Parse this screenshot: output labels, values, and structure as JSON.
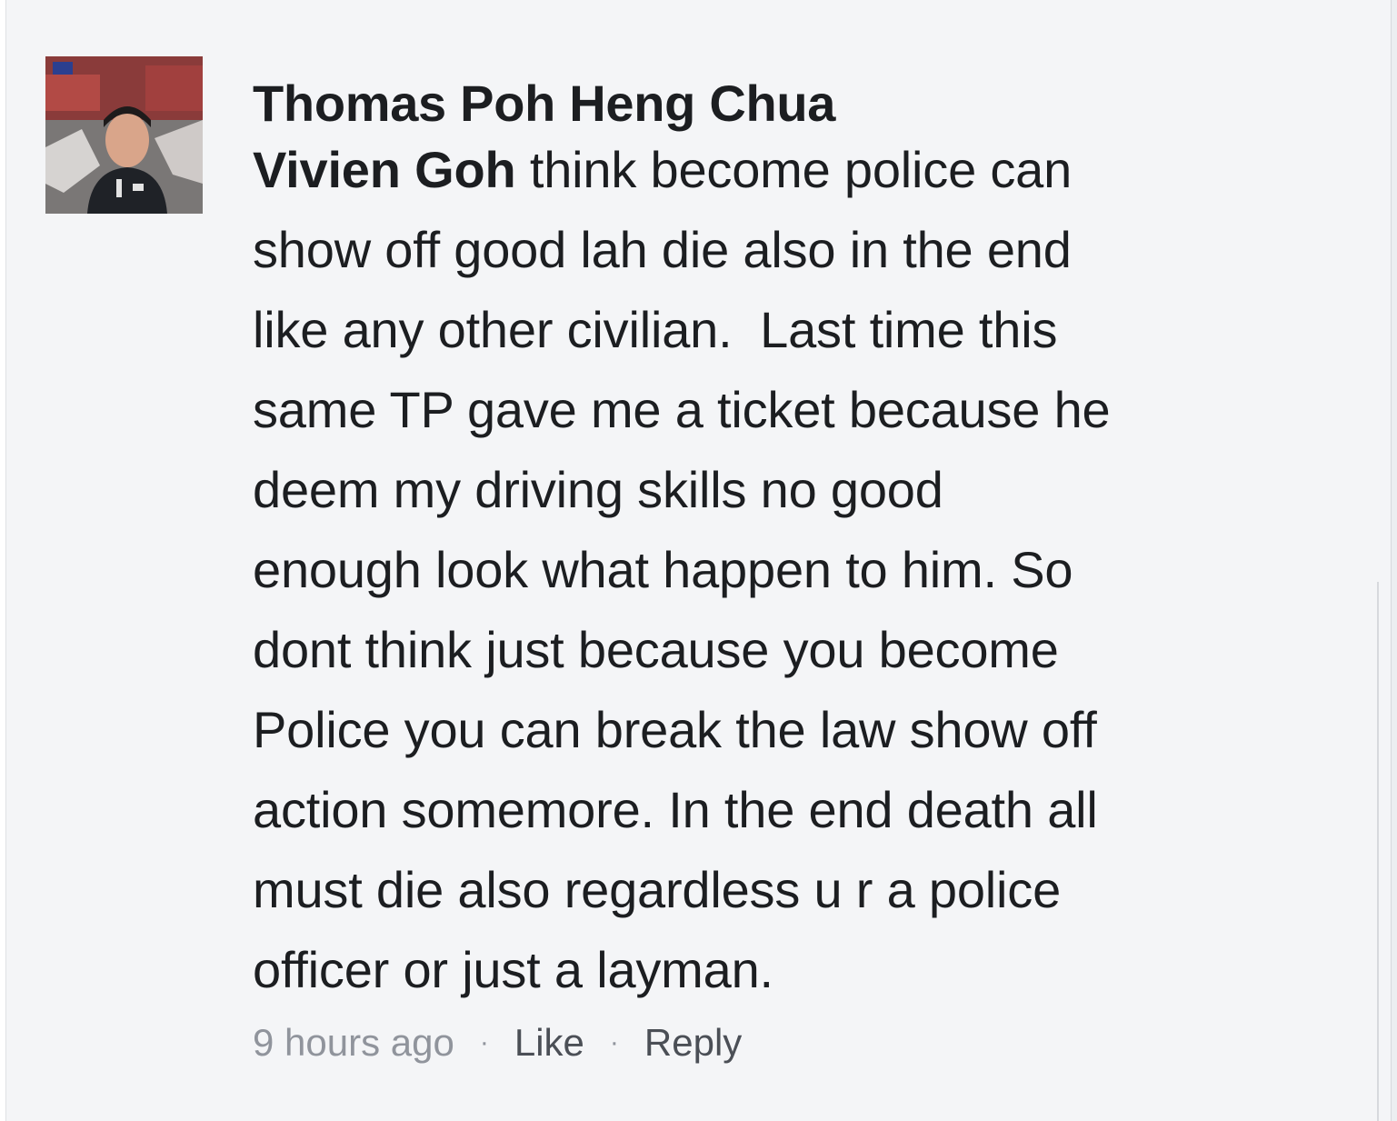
{
  "comment": {
    "author": "Thomas Poh Heng Chua",
    "mention": "Vivien Goh",
    "lines": [
      " think become police can",
      "show off good lah die also in the end",
      "like any other civilian.  Last time this",
      "same TP gave me a ticket because he",
      "deem my driving skills no good",
      "enough look what happen to him. So",
      "dont think just because you become",
      "Police you can break the law show off",
      "action somemore. In the end death all",
      "must die also regardless u r a police",
      "officer or just a layman."
    ],
    "timestamp": "9 hours ago",
    "separator": "·",
    "like_label": "Like",
    "reply_label": "Reply"
  },
  "colors": {
    "background": "#f4f5f7",
    "text": "#1c1e21",
    "meta_gray": "#90949c",
    "action_gray": "#4b4f56"
  }
}
